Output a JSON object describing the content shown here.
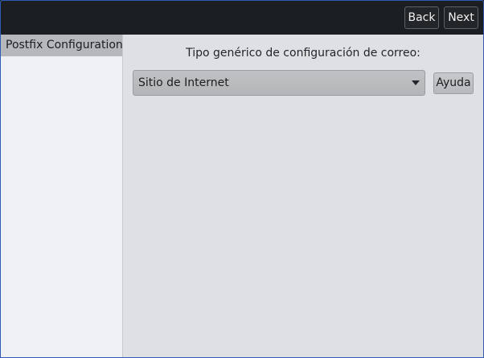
{
  "nav": {
    "back_label": "Back",
    "next_label": "Next"
  },
  "sidebar": {
    "items": [
      {
        "label": "Postfix Configuration",
        "selected": true
      }
    ]
  },
  "main": {
    "question": "Tipo genérico de configuración de correo:",
    "select": {
      "value": "Sitio de Internet",
      "icon": "chevron-down-icon"
    },
    "help_label": "Ayuda"
  },
  "colors": {
    "topbar": "#1c1f22",
    "sidebar_bg": "#eff0f4",
    "sidebar_selected": "#b6b8bb",
    "main_bg": "#dfe0e3",
    "window_border": "#2f5bb7"
  }
}
